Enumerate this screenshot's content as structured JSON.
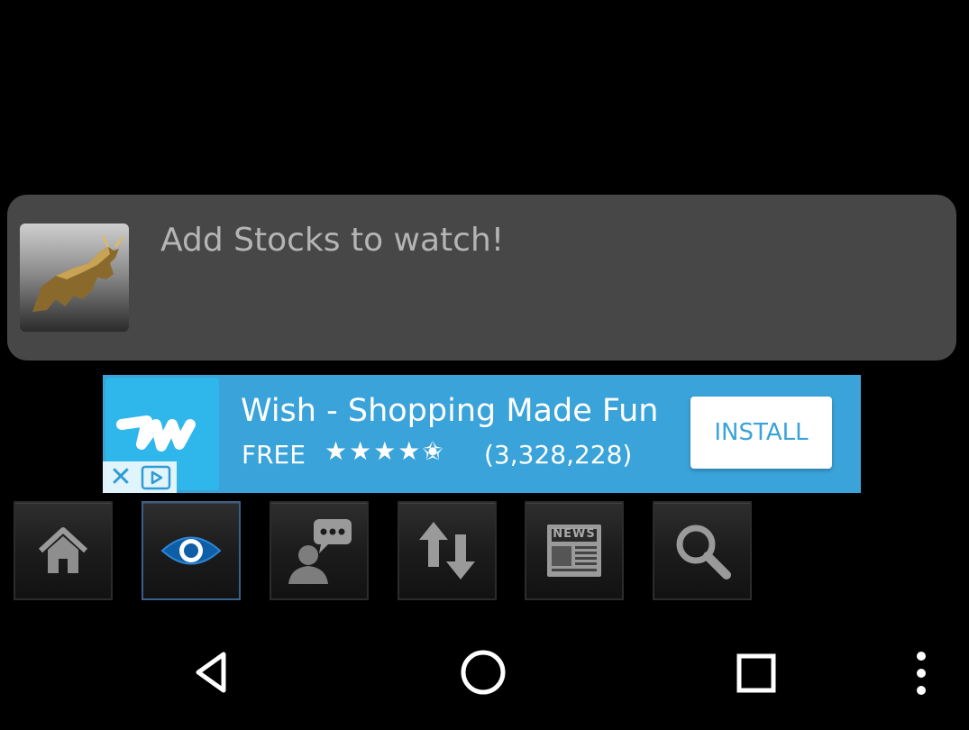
{
  "watchlist": {
    "empty_message": "Add Stocks to watch!",
    "logo_icon": "bull-icon"
  },
  "ad": {
    "title": "Wish - Shopping Made Fun",
    "price": "FREE",
    "rating_stars": "★★★★✬",
    "rating": 4.5,
    "review_count": "(3,328,228)",
    "install_label": "INSTALL",
    "logo_icon": "wish-logo",
    "accent": "#3aa3d9"
  },
  "toolbar": {
    "buttons": [
      {
        "name": "home",
        "icon": "home-icon",
        "active": false
      },
      {
        "name": "watchlist",
        "icon": "eye-icon",
        "active": true
      },
      {
        "name": "chat",
        "icon": "chat-person-icon",
        "active": false
      },
      {
        "name": "movers",
        "icon": "up-down-arrows-icon",
        "active": false
      },
      {
        "name": "news",
        "icon": "news-icon",
        "news_label": "NEWS",
        "active": false
      },
      {
        "name": "search",
        "icon": "search-icon",
        "active": false
      }
    ]
  },
  "navbar": {
    "icons": [
      "back-icon",
      "home-circle-icon",
      "recents-icon",
      "overflow-menu-icon"
    ]
  },
  "colors": {
    "background": "#000000",
    "card": "#474747",
    "active_border": "#3b5f8c"
  }
}
